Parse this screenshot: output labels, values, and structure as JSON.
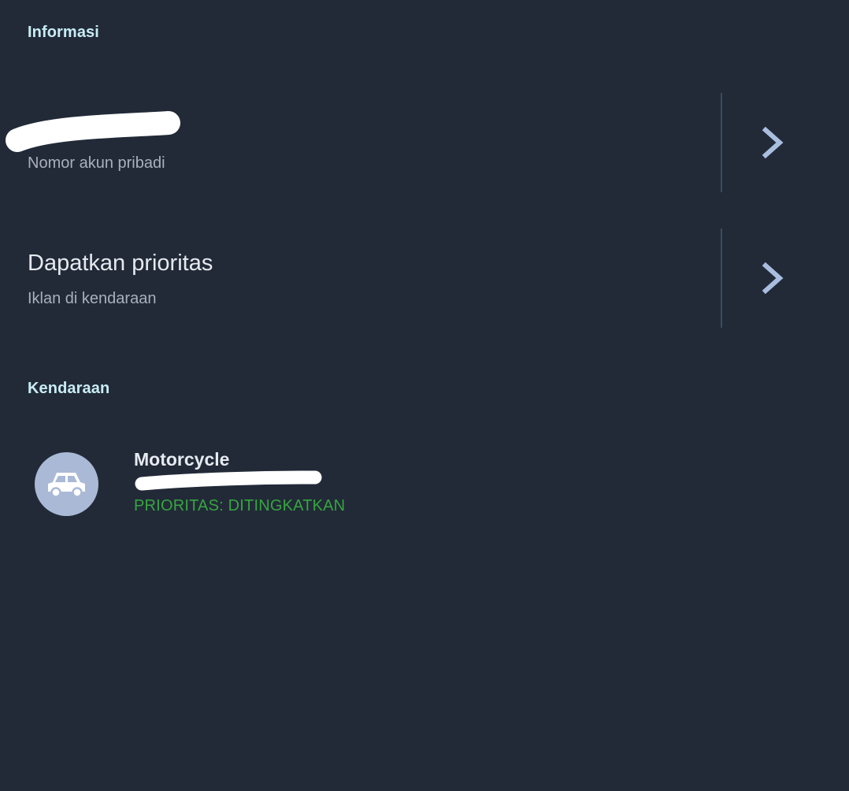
{
  "sections": {
    "info_title": "Informasi",
    "vehicle_title": "Kendaraan"
  },
  "account_row": {
    "title": "",
    "subtitle": "Nomor akun pribadi",
    "icon": "chevron-right-icon"
  },
  "priority_row": {
    "title": "Dapatkan prioritas",
    "subtitle": "Iklan di kendaraan",
    "icon": "chevron-right-icon"
  },
  "vehicle": {
    "icon": "car-icon",
    "name": "Motorcycle",
    "plate": "",
    "status": "PRIORITAS: DITINGKATKAN"
  },
  "colors": {
    "background": "#222a38",
    "section_title": "#c9ecf3",
    "chevron": "#a9bedf",
    "divider": "#3a4a60",
    "status_green": "#35a63e",
    "avatar_bg": "#aab9d6"
  }
}
